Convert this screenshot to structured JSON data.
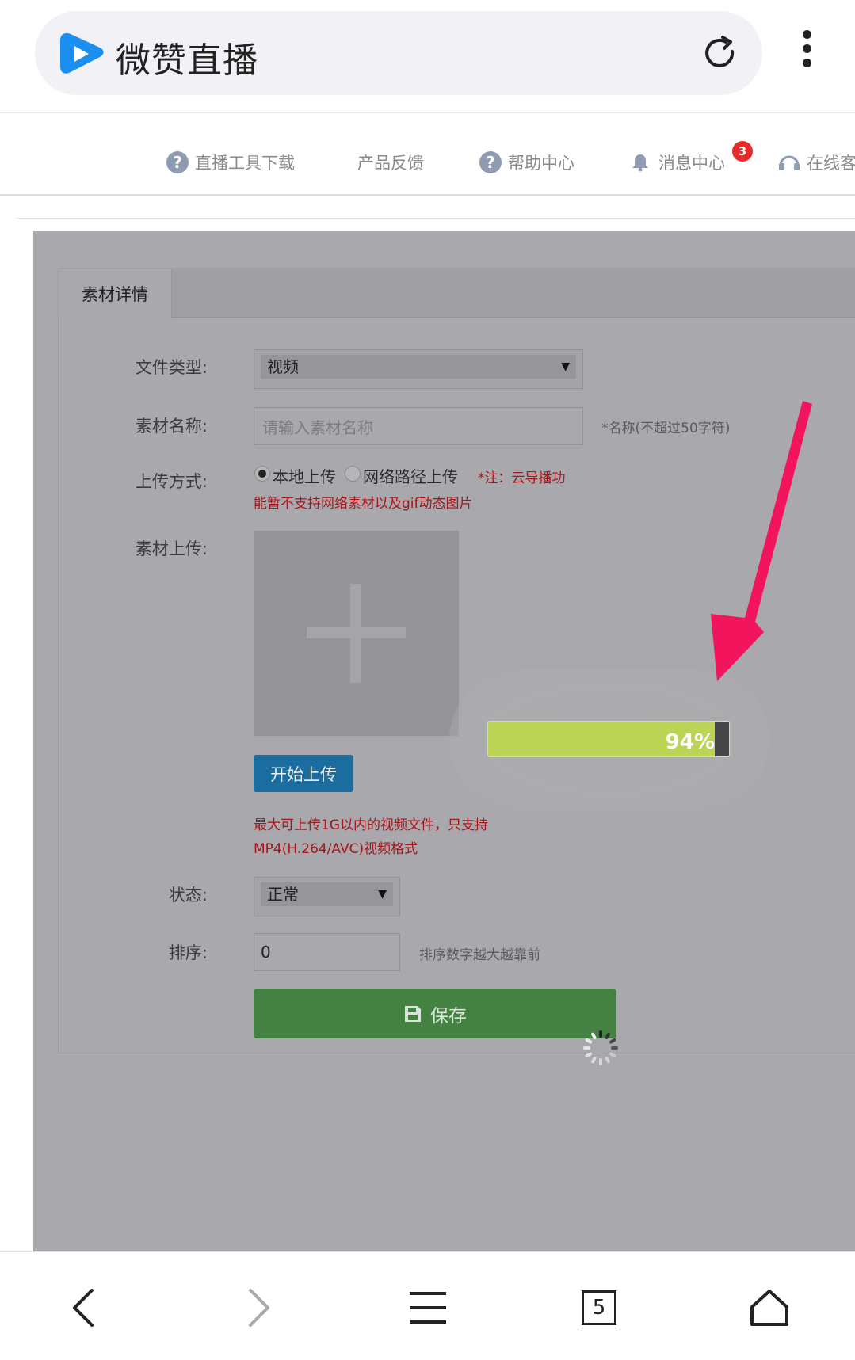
{
  "browser": {
    "title": "微赞直播",
    "tab_count": "5"
  },
  "nav": {
    "items": [
      {
        "label": "直播工具下载"
      },
      {
        "label": "产品反馈"
      },
      {
        "label": "帮助中心"
      },
      {
        "label": "消息中心"
      },
      {
        "label": "在线客"
      }
    ],
    "message_badge": "3"
  },
  "panel": {
    "tab_label": "素材详情",
    "file_type_label": "文件类型:",
    "file_type_value": "视频",
    "name_label": "素材名称:",
    "name_placeholder": "请输入素材名称",
    "name_hint": "*名称(不超过50字符)",
    "upload_method_label": "上传方式:",
    "option_local": "本地上传",
    "option_network": "网络路径上传",
    "note_line1": "*注：云导播功",
    "note_line2": "能暂不支持网络素材以及gif动态图片",
    "material_upload_label": "素材上传:",
    "start_upload_button": "开始上传",
    "upload_limit_line1": "最大可上传1G以内的视频文件，只支持",
    "upload_limit_line2": "MP4(H.264/AVC)视频格式",
    "status_label": "状态:",
    "status_value": "正常",
    "sort_label": "排序:",
    "sort_value": "0",
    "sort_hint": "排序数字越大越靠前",
    "save_button": "保存"
  },
  "progress": {
    "value": 0.94,
    "label": "94%"
  },
  "colors": {
    "overlay": "#a9a8ac",
    "progress_fill": "#bbd455",
    "save_button": "#438243",
    "upload_button": "#1a6d9e",
    "annotation_arrow": "#f2155e",
    "badge": "#e62b2b"
  }
}
